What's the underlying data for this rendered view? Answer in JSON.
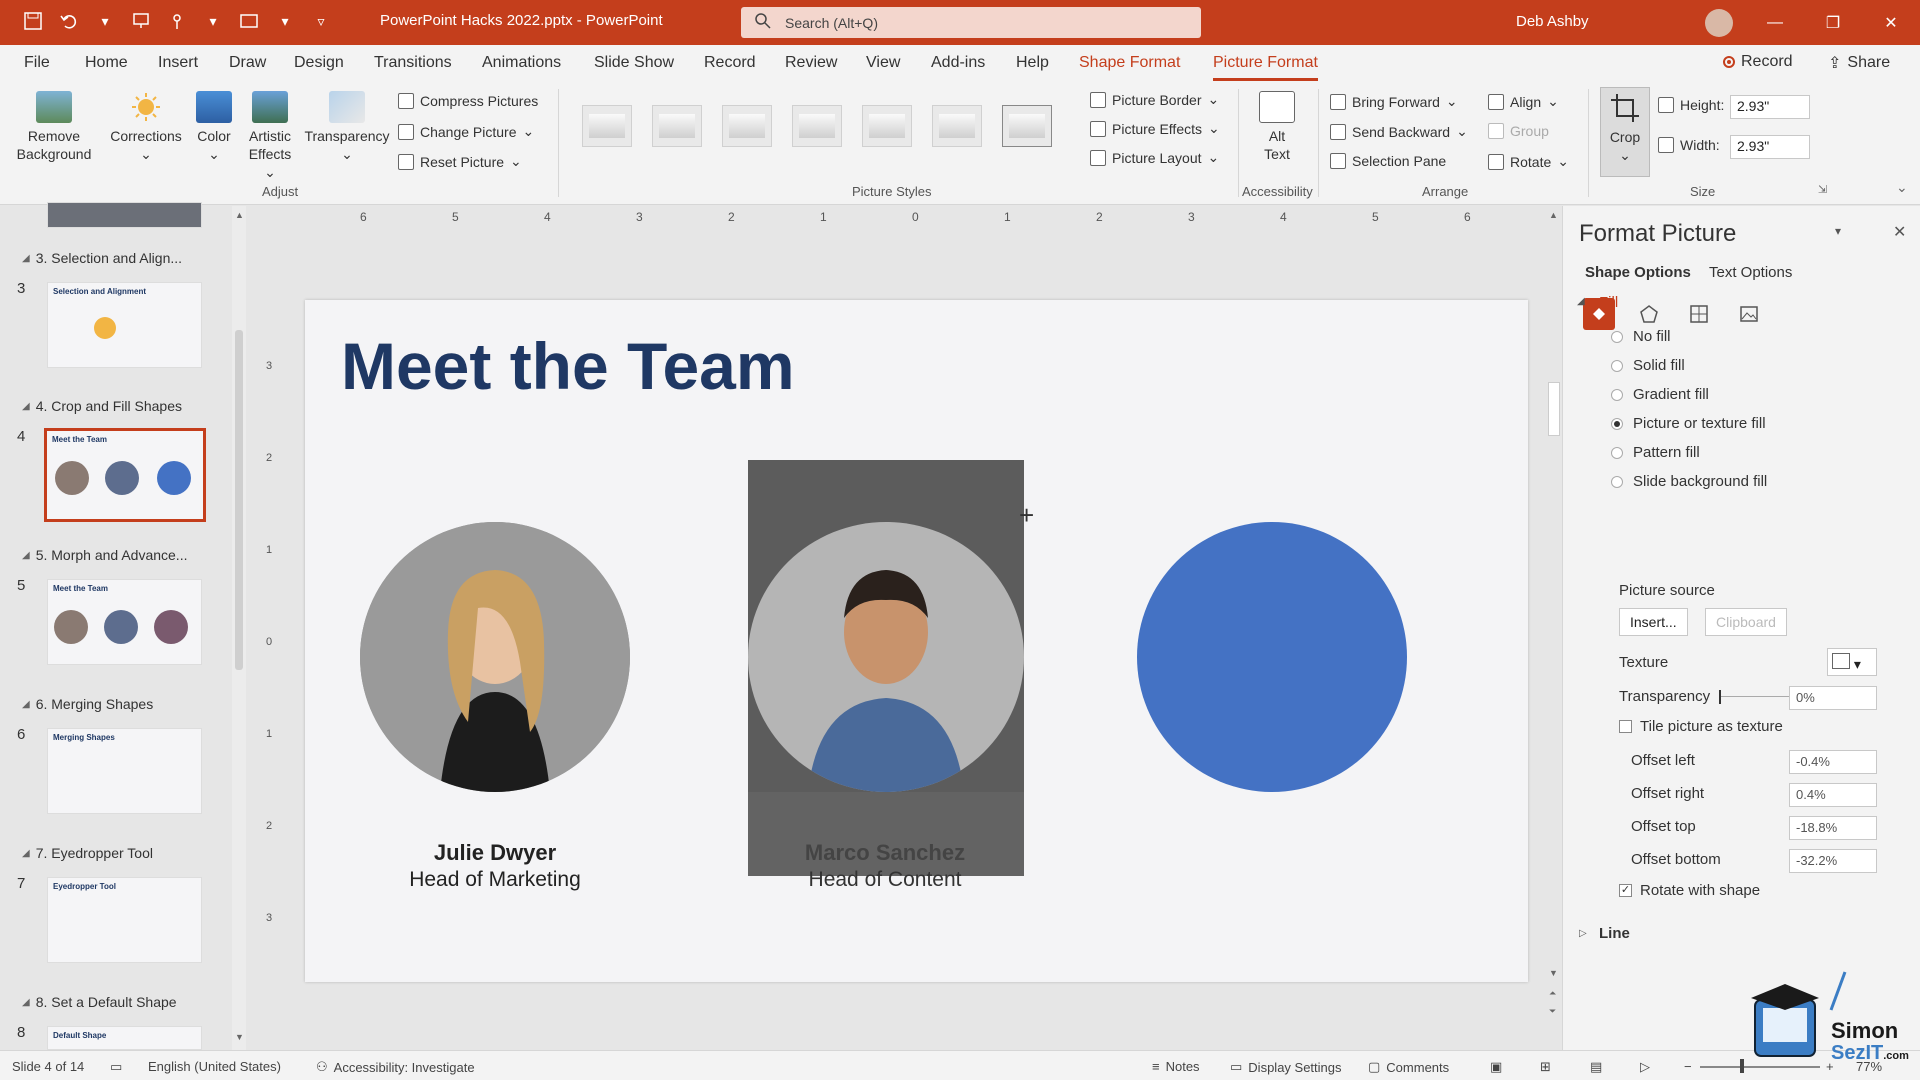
{
  "window": {
    "title": "PowerPoint Hacks 2022.pptx  -  PowerPoint",
    "search_placeholder": "Search (Alt+Q)",
    "user_name": "Deb Ashby"
  },
  "tabs": [
    "File",
    "Home",
    "Insert",
    "Draw",
    "Design",
    "Transitions",
    "Animations",
    "Slide Show",
    "Record",
    "Review",
    "View",
    "Add-ins",
    "Help",
    "Shape Format",
    "Picture Format"
  ],
  "header_buttons": {
    "record": "Record",
    "share": "Share"
  },
  "ribbon": {
    "adjust": {
      "remove_background": [
        "Remove",
        "Background"
      ],
      "corrections": "Corrections",
      "color": "Color",
      "artistic_effects": [
        "Artistic",
        "Effects"
      ],
      "transparency": "Transparency",
      "compress": "Compress Pictures",
      "change": "Change Picture",
      "reset": "Reset Picture",
      "label": "Adjust"
    },
    "picture_styles": {
      "border": "Picture Border",
      "effects": "Picture Effects",
      "layout": "Picture Layout",
      "label": "Picture Styles"
    },
    "accessibility": {
      "alt_text": [
        "Alt",
        "Text"
      ],
      "label": "Accessibility"
    },
    "arrange": {
      "bring_forward": "Bring Forward",
      "send_backward": "Send Backward",
      "selection_pane": "Selection Pane",
      "align": "Align",
      "group": "Group",
      "rotate": "Rotate",
      "label": "Arrange"
    },
    "size": {
      "crop": "Crop",
      "height_label": "Height:",
      "height_value": "2.93\"",
      "width_label": "Width:",
      "width_value": "2.93\"",
      "label": "Size"
    }
  },
  "thumbnails": [
    {
      "section": "3. Selection and Align...",
      "num": "3",
      "thumb_title": "Selection and Alignment"
    },
    {
      "section": "4. Crop and Fill Shapes",
      "num": "4",
      "thumb_title": "Meet the Team",
      "selected": true
    },
    {
      "section": "5. Morph and Advance...",
      "num": "5",
      "thumb_title": "Meet the Team"
    },
    {
      "section": "6. Merging Shapes",
      "num": "6",
      "thumb_title": "Merging Shapes"
    },
    {
      "section": "7. Eyedropper Tool",
      "num": "7",
      "thumb_title": "Eyedropper Tool"
    },
    {
      "section": "8. Set a Default Shape",
      "num": "8",
      "thumb_title": "Default Shape"
    }
  ],
  "ruler_h": [
    "6",
    "5",
    "4",
    "3",
    "2",
    "1",
    "0",
    "1",
    "2",
    "3",
    "4",
    "5",
    "6"
  ],
  "ruler_v": [
    "3",
    "2",
    "1",
    "0",
    "1",
    "2",
    "3"
  ],
  "slide": {
    "title": "Meet the Team",
    "people": [
      {
        "name": "Julie Dwyer",
        "role": "Head of Marketing"
      },
      {
        "name": "Marco Sanchez",
        "role": "Head of Content"
      }
    ]
  },
  "format_pane": {
    "title": "Format Picture",
    "tabs": [
      "Shape Options",
      "Text Options"
    ],
    "fill_header": "Fill",
    "fill_options": [
      "No fill",
      "Solid fill",
      "Gradient fill",
      "Picture or texture fill",
      "Pattern fill",
      "Slide background fill"
    ],
    "selected_fill": "Picture or texture fill",
    "picture_source": "Picture source",
    "insert_button": "Insert...",
    "clipboard_button": "Clipboard",
    "texture": "Texture",
    "transparency_label": "Transparency",
    "transparency_value": "0%",
    "tile_label": "Tile picture as texture",
    "offset_left_label": "Offset left",
    "offset_left": "-0.4%",
    "offset_right_label": "Offset right",
    "offset_right": "0.4%",
    "offset_top_label": "Offset top",
    "offset_top": "-18.8%",
    "offset_bottom_label": "Offset bottom",
    "offset_bottom": "-32.2%",
    "rotate_label": "Rotate with shape",
    "line_header": "Line"
  },
  "statusbar": {
    "slide": "Slide 4 of 14",
    "language": "English (United States)",
    "accessibility": "Accessibility: Investigate",
    "notes": "Notes",
    "display": "Display Settings",
    "comments": "Comments",
    "zoom": "77%"
  },
  "logo_text": [
    "Simon",
    "SezIT",
    ".com"
  ],
  "colors": {
    "accent": "#c43e1c",
    "title_blue": "#1f3864",
    "circle_blue": "#4472c4"
  }
}
